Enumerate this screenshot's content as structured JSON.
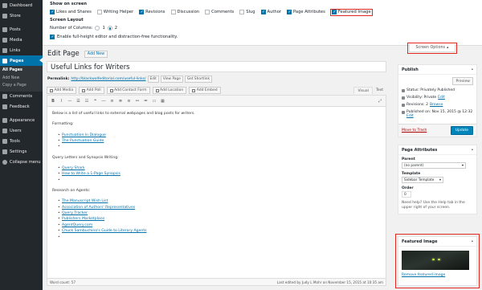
{
  "sidebar": {
    "items": [
      {
        "label": "Dashboard"
      },
      {
        "label": "Store"
      },
      {
        "label": "Posts"
      },
      {
        "label": "Media"
      },
      {
        "label": "Links"
      },
      {
        "label": "Pages"
      },
      {
        "label": "Comments"
      },
      {
        "label": "Feedback"
      },
      {
        "label": "Appearance"
      },
      {
        "label": "Users"
      },
      {
        "label": "Tools"
      },
      {
        "label": "Settings"
      },
      {
        "label": "Collapse menu"
      }
    ],
    "pages_submenu": [
      "All Pages",
      "Add New",
      "Copy a Page"
    ]
  },
  "screen_options": {
    "heading": "Show on screen",
    "boxes": [
      {
        "label": "Likes and Shares",
        "checked": true
      },
      {
        "label": "Writing Helper",
        "checked": false
      },
      {
        "label": "Revisions",
        "checked": true
      },
      {
        "label": "Discussion",
        "checked": false
      },
      {
        "label": "Comments",
        "checked": false
      },
      {
        "label": "Slug",
        "checked": false
      },
      {
        "label": "Author",
        "checked": true
      },
      {
        "label": "Page Attributes",
        "checked": true
      },
      {
        "label": "Featured Image",
        "checked": true
      }
    ],
    "layout_heading": "Screen Layout",
    "columns_label": "Number of Columns:",
    "col1": "1",
    "col2": "2",
    "fullheight_label": "Enable full-height editor and distraction-free functionality.",
    "toggle_label": "Screen Options"
  },
  "header": {
    "title": "Edit Page",
    "add_new": "Add New"
  },
  "editor": {
    "post_title": "Useful Links for Writers",
    "permalink_label": "Permalink:",
    "permalink_url": "http://blackwolfeditorial.com/useful-links/",
    "edit_btn": "Edit",
    "view_page_btn": "View Page",
    "shortlink_btn": "Get Shortlink",
    "media_buttons": [
      "Add Media",
      "Add Poll",
      "Add Contact Form",
      "Add Location",
      "Add Embed"
    ],
    "tab_visual": "Visual",
    "tab_text": "Text",
    "intro": "Below is a list of useful links to external webpages and blog posts for writers.",
    "formatting_heading": "Formatting:",
    "formatting_links": [
      "Punctuation in Dialogue",
      "The Punctuation Guide"
    ],
    "query_heading": "Query Letters and Synopsis Writing:",
    "query_links": [
      "Query Shark",
      "How to Write a 1-Page Synopsis"
    ],
    "research_heading": "Research on Agents:",
    "research_links": [
      "The Manuscript Wish List",
      "Association of Authors' Representatives",
      "Query Tracker",
      "Publishers Marketplace",
      "AgentQuery.com",
      "Chuck Sambuchino's Guide to Literary Agents"
    ],
    "word_count": "Word count: 57",
    "last_edited": "Last edited by Judy L Mohr on November 15, 2015 at 10:35 am"
  },
  "publish": {
    "title": "Publish",
    "preview_btn": "Preview",
    "status": "Status: Privately Published",
    "visibility_label": "Visibility: Private",
    "visibility_edit": "Edit",
    "revisions_label": "Revisions: 2",
    "revisions_link": "Browse",
    "published_label": "Published on: Nov 15, 2015 @ 12:32",
    "published_edit": "Edit",
    "trash": "Move to Trash",
    "update_btn": "Update"
  },
  "page_attributes": {
    "title": "Page Attributes",
    "parent_label": "Parent",
    "parent_value": "(no parent)",
    "template_label": "Template",
    "template_value": "Sidebar Template",
    "order_label": "Order",
    "order_value": "0",
    "help_text": "Need help? Use the Help tab in the upper right of your screen."
  },
  "featured_image": {
    "title": "Featured Image",
    "remove_link": "Remove featured image"
  },
  "colors": {
    "sidebar_bg": "#23282d",
    "accent": "#0073aa",
    "highlight": "#e02a20",
    "update_button": "#0085ba"
  }
}
